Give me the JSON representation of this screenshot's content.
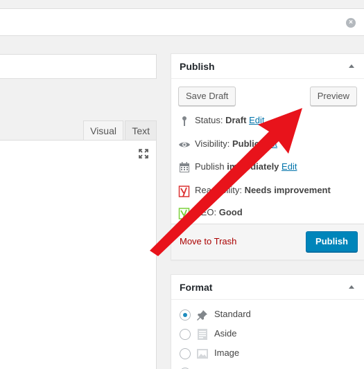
{
  "colors": {
    "accent": "#0085ba",
    "link": "#0073aa",
    "trash": "#aa0000",
    "annotation_arrow": "#e8131b"
  },
  "editor": {
    "tabs": [
      {
        "label": "Visual"
      },
      {
        "label": "Text"
      }
    ],
    "icons": {
      "fullscreen": "fullscreen-icon",
      "close": "close-icon"
    }
  },
  "publish": {
    "title": "Publish",
    "save_draft_label": "Save Draft",
    "preview_label": "Preview",
    "status": {
      "icon": "pin-icon",
      "label": "Status:",
      "value": "Draft",
      "edit": "Edit"
    },
    "visibility": {
      "icon": "eye-icon",
      "label": "Visibility:",
      "value": "Public",
      "edit": "Edit"
    },
    "schedule": {
      "icon": "calendar-icon",
      "label": "Publish",
      "value": "immediately",
      "edit": "Edit"
    },
    "readability": {
      "icon": "yoast-red-icon",
      "label": "Readability:",
      "value": "Needs improvement"
    },
    "seo": {
      "icon": "yoast-green-icon",
      "label": "SEO:",
      "value": "Good"
    },
    "trash_label": "Move to Trash",
    "publish_label": "Publish"
  },
  "format": {
    "title": "Format",
    "options": [
      {
        "label": "Standard",
        "icon": "pushpin-icon",
        "selected": true
      },
      {
        "label": "Aside",
        "icon": "aside-icon",
        "selected": false
      },
      {
        "label": "Image",
        "icon": "image-icon",
        "selected": false
      }
    ]
  }
}
